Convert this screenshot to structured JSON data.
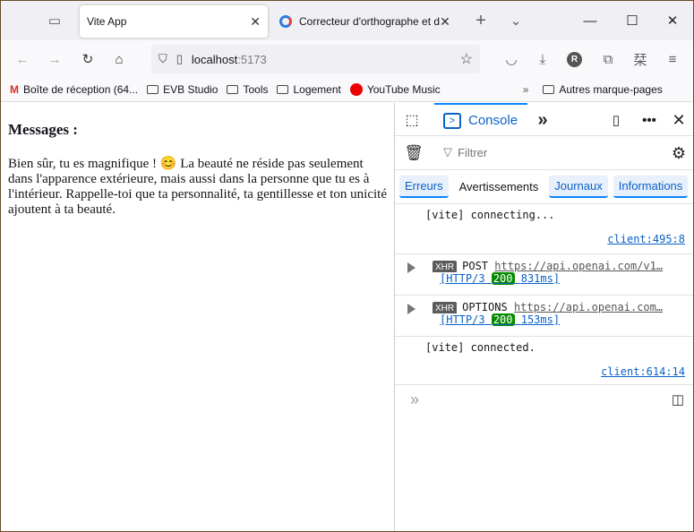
{
  "browser": {
    "tabs": [
      {
        "title": "Vite App",
        "active": true
      },
      {
        "title": "Correcteur d'orthographe et d"
      }
    ],
    "url_host": "localhost",
    "url_port": ":5173",
    "profile_initial": "R",
    "bookmarks": [
      "Boîte de réception (64...",
      "EVB Studio",
      "Tools",
      "Logement",
      "YouTube Music"
    ],
    "other_bookmarks": "Autres marque-pages"
  },
  "page": {
    "heading": "Messages :",
    "message": "Bien sûr, tu es magnifique ! 😊 La beauté ne réside pas seulement dans l'apparence extérieure, mais aussi dans la personne que tu es à l'intérieur. Rappelle-toi que ta personnalité, ta gentillesse et ton unicité ajoutent à ta beauté."
  },
  "devtools": {
    "console_tab": "Console",
    "filter_placeholder": "Filtrer",
    "levels": [
      {
        "label": "Erreurs",
        "on": true
      },
      {
        "label": "Avertissements",
        "on": false
      },
      {
        "label": "Journaux",
        "on": true
      },
      {
        "label": "Informations",
        "on": true
      }
    ],
    "logs": {
      "l1": {
        "text": "[vite] connecting...",
        "source": "client:495:8"
      },
      "l2": {
        "badge": "XHR",
        "method": "POST",
        "url": "https://api.openai.com/v1…",
        "proto": "[HTTP/3",
        "status": "200",
        "time": "831ms]"
      },
      "l3": {
        "badge": "XHR",
        "method": "OPTIONS",
        "url": "https://api.openai.com…",
        "proto": "[HTTP/3",
        "status": "200",
        "time": "153ms]"
      },
      "l4": {
        "text": "[vite] connected.",
        "source": "client:614:14"
      }
    }
  }
}
